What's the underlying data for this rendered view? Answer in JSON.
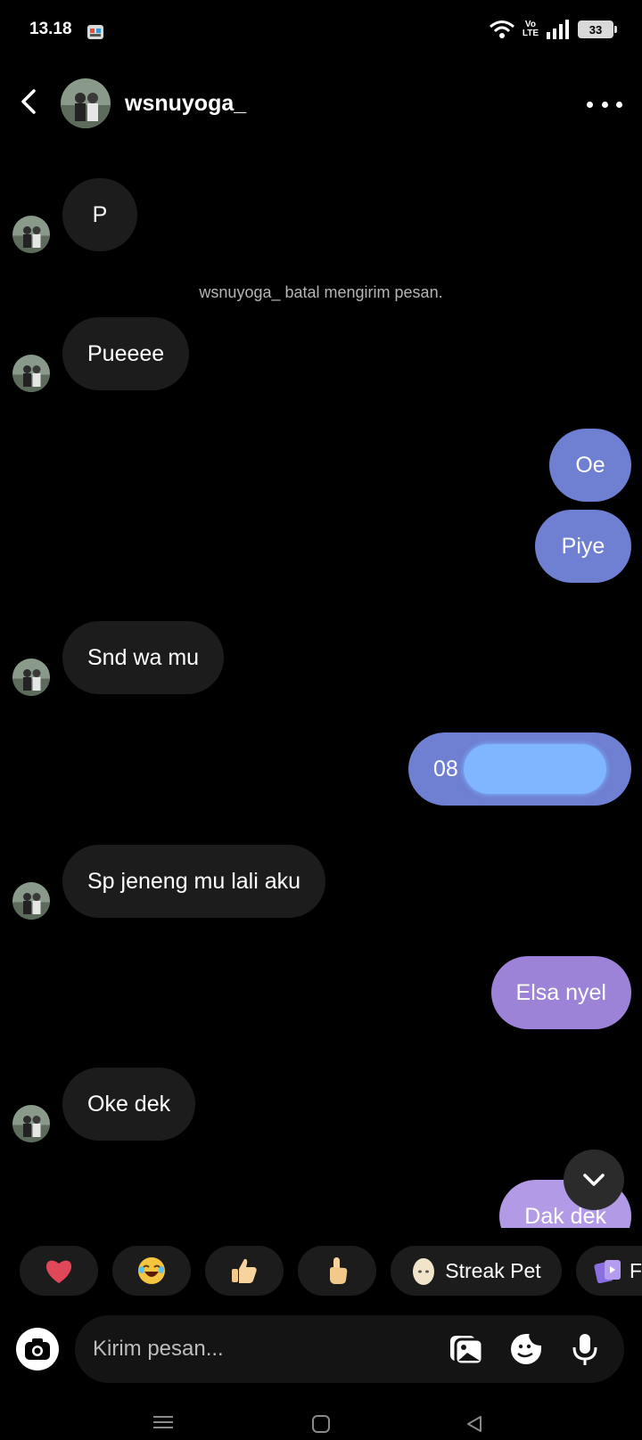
{
  "status_bar": {
    "time": "13.18",
    "volte_top": "Vo",
    "volte_bottom": "LTE",
    "battery": "33"
  },
  "header": {
    "username": "wsnuyoga_"
  },
  "messages": {
    "m1": "P",
    "system_note": "wsnuyoga_ batal mengirim pesan.",
    "m2": "Pueeee",
    "m3": "Oe",
    "m4": "Piye",
    "m5": "Snd wa mu",
    "m6": "08",
    "m7": "Sp jeneng mu lali aku",
    "m8": "Elsa nyel",
    "m9": "Oke dek",
    "m10": "Dak dek"
  },
  "reactions": {
    "heart": "❤️",
    "laugh": "😂",
    "thumbs_up": "👍",
    "point": "👆",
    "streak_label": "Streak Pet",
    "next_partial": "F"
  },
  "composer": {
    "placeholder": "Kirim pesan..."
  },
  "colors": {
    "background": "#000000",
    "incoming": "#1c1c1c",
    "outgoing_blue": "#6f7fd1",
    "outgoing_purple": "#9c83d8"
  }
}
